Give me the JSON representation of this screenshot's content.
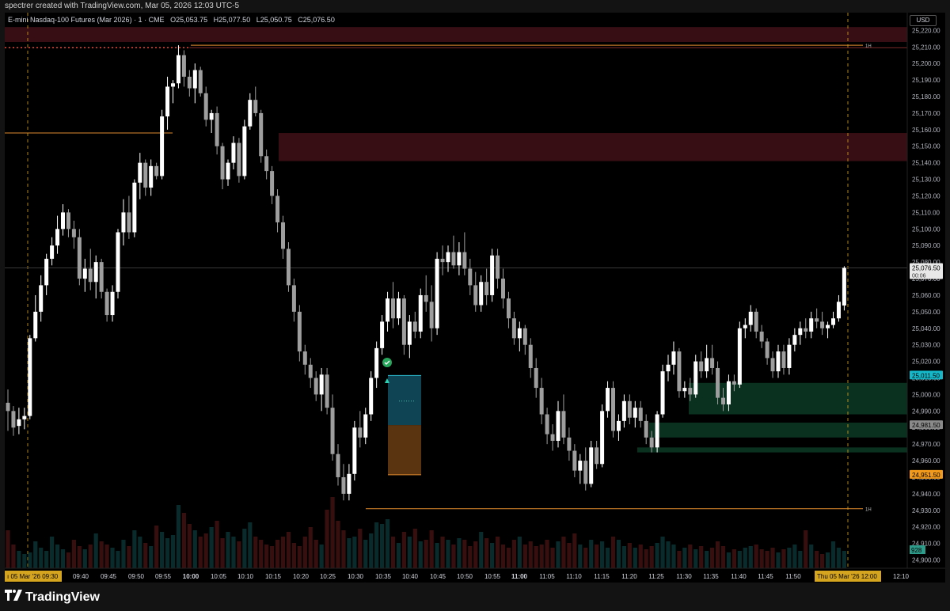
{
  "header": {
    "credit": "spectrer created with TradingView.com, Mar 05, 2026 12:03 UTC-5",
    "instrument": "E-mini Nasdaq-100 Futures (Mar 2026) · 1 · CME",
    "open": "O25,053.75",
    "high": "H25,077.50",
    "low": "L25,050.75",
    "close": "C25,076.50",
    "currency": "USD"
  },
  "footer": {
    "brand": "TradingView"
  },
  "colors": {
    "background": "#000000",
    "up": "#ffffff",
    "down": "#9e9e9e",
    "supply_zone": "#3a0f14",
    "demand_zone": "#0c3a26",
    "level": "#e08a2e",
    "session": "#d6a520",
    "tp_box": "#0e4453",
    "sl_box": "#5a3310"
  },
  "chart_data": {
    "type": "candlestick",
    "ylim": [
      24895,
      25224
    ],
    "y_ticks": [
      "25,220.00",
      "25,210.00",
      "25,200.00",
      "25,190.00",
      "25,180.00",
      "25,170.00",
      "25,160.00",
      "25,150.00",
      "25,140.00",
      "25,130.00",
      "25,120.00",
      "25,110.00",
      "25,100.00",
      "25,090.00",
      "25,080.00",
      "25,070.00",
      "25,060.00",
      "25,050.00",
      "25,040.00",
      "25,030.00",
      "25,020.00",
      "25,010.00",
      "25,000.00",
      "24,990.00",
      "24,980.00",
      "24,970.00",
      "24,960.00",
      "24,950.00",
      "24,940.00",
      "24,930.00",
      "24,920.00",
      "24,910.00",
      "24,900.00"
    ],
    "x_labels": [
      {
        "t": "09:40",
        "bold": false
      },
      {
        "t": "09:45",
        "bold": false
      },
      {
        "t": "09:50",
        "bold": false
      },
      {
        "t": "09:55",
        "bold": false
      },
      {
        "t": "10:00",
        "bold": true
      },
      {
        "t": "10:05",
        "bold": false
      },
      {
        "t": "10:10",
        "bold": false
      },
      {
        "t": "10:15",
        "bold": false
      },
      {
        "t": "10:20",
        "bold": false
      },
      {
        "t": "10:25",
        "bold": false
      },
      {
        "t": "10:30",
        "bold": false
      },
      {
        "t": "10:35",
        "bold": false
      },
      {
        "t": "10:40",
        "bold": false
      },
      {
        "t": "10:45",
        "bold": false
      },
      {
        "t": "10:50",
        "bold": false
      },
      {
        "t": "10:55",
        "bold": false
      },
      {
        "t": "11:00",
        "bold": true
      },
      {
        "t": "11:05",
        "bold": false
      },
      {
        "t": "11:10",
        "bold": false
      },
      {
        "t": "11:15",
        "bold": false
      },
      {
        "t": "11:20",
        "bold": false
      },
      {
        "t": "11:25",
        "bold": false
      },
      {
        "t": "11:30",
        "bold": false
      },
      {
        "t": "11:35",
        "bold": false
      },
      {
        "t": "11:40",
        "bold": false
      },
      {
        "t": "11:45",
        "bold": false
      },
      {
        "t": "11:50",
        "bold": false
      },
      {
        "t": "12:10",
        "bold": false
      }
    ],
    "session_labels": {
      "start": "ı 05 Mar '26  09:30",
      "end": "Thu 05 Mar '26  12:00"
    },
    "price_tags": [
      {
        "price": 25076.5,
        "label": "25,076.50",
        "sub": "00:06",
        "style": "current"
      },
      {
        "price": 25011.5,
        "label": "25,011.50",
        "style": "teal"
      },
      {
        "price": 24981.5,
        "label": "24,981.50",
        "style": "gray"
      },
      {
        "price": 24951.5,
        "label": "24,951.50",
        "style": "orange"
      }
    ],
    "volume_tag": "928",
    "levels": [
      {
        "price": 25211,
        "x0": 241,
        "x1": 1090,
        "label": "1H"
      },
      {
        "price": 24931,
        "x0": 462,
        "x1": 1090,
        "label": "1H"
      },
      {
        "price": 25158,
        "x0": 6,
        "x1": 218,
        "label": ""
      }
    ],
    "zones": [
      {
        "top": 25222,
        "bottom": 25213,
        "kind": "supply"
      },
      {
        "top": 25158,
        "bottom": 25141,
        "kind": "supply",
        "x0": 352
      },
      {
        "top": 25007,
        "bottom": 24988,
        "kind": "demand",
        "x0": 870
      },
      {
        "top": 24983,
        "bottom": 24974,
        "kind": "demand",
        "x0": 820
      },
      {
        "top": 24968,
        "bottom": 24965,
        "kind": "demand",
        "x0": 805
      }
    ],
    "trade": {
      "entry": 24981.5,
      "target": 25011.5,
      "stop": 24951.5
    },
    "candles": [
      {
        "o": 24995,
        "h": 25003,
        "l": 24978,
        "c": 24990
      },
      {
        "o": 24990,
        "h": 24993,
        "l": 24975,
        "c": 24980
      },
      {
        "o": 24981,
        "h": 24992,
        "l": 24976,
        "c": 24985
      },
      {
        "o": 24985,
        "h": 24992,
        "l": 24979,
        "c": 24987
      },
      {
        "o": 24987,
        "h": 25036,
        "l": 24985,
        "c": 25034
      },
      {
        "o": 25034,
        "h": 25060,
        "l": 25032,
        "c": 25050
      },
      {
        "o": 25050,
        "h": 25072,
        "l": 25044,
        "c": 25066
      },
      {
        "o": 25066,
        "h": 25085,
        "l": 25060,
        "c": 25082
      },
      {
        "o": 25082,
        "h": 25095,
        "l": 25078,
        "c": 25090
      },
      {
        "o": 25090,
        "h": 25108,
        "l": 25085,
        "c": 25100
      },
      {
        "o": 25100,
        "h": 25115,
        "l": 25096,
        "c": 25110
      },
      {
        "o": 25110,
        "h": 25112,
        "l": 25095,
        "c": 25100
      },
      {
        "o": 25100,
        "h": 25105,
        "l": 25088,
        "c": 25095
      },
      {
        "o": 25095,
        "h": 25100,
        "l": 25066,
        "c": 25070
      },
      {
        "o": 25070,
        "h": 25082,
        "l": 25062,
        "c": 25076
      },
      {
        "o": 25076,
        "h": 25088,
        "l": 25063,
        "c": 25068
      },
      {
        "o": 25068,
        "h": 25084,
        "l": 25058,
        "c": 25080
      },
      {
        "o": 25080,
        "h": 25082,
        "l": 25058,
        "c": 25062
      },
      {
        "o": 25062,
        "h": 25064,
        "l": 25044,
        "c": 25048
      },
      {
        "o": 25048,
        "h": 25066,
        "l": 25044,
        "c": 25062
      },
      {
        "o": 25062,
        "h": 25100,
        "l": 25058,
        "c": 25098
      },
      {
        "o": 25098,
        "h": 25118,
        "l": 25090,
        "c": 25110
      },
      {
        "o": 25110,
        "h": 25120,
        "l": 25094,
        "c": 25098
      },
      {
        "o": 25098,
        "h": 25130,
        "l": 25095,
        "c": 25128
      },
      {
        "o": 25128,
        "h": 25146,
        "l": 25118,
        "c": 25140
      },
      {
        "o": 25140,
        "h": 25142,
        "l": 25120,
        "c": 25125
      },
      {
        "o": 25125,
        "h": 25142,
        "l": 25120,
        "c": 25138
      },
      {
        "o": 25138,
        "h": 25140,
        "l": 25130,
        "c": 25132
      },
      {
        "o": 25132,
        "h": 25172,
        "l": 25130,
        "c": 25168
      },
      {
        "o": 25168,
        "h": 25192,
        "l": 25160,
        "c": 25186
      },
      {
        "o": 25186,
        "h": 25190,
        "l": 25176,
        "c": 25188
      },
      {
        "o": 25188,
        "h": 25211,
        "l": 25185,
        "c": 25205
      },
      {
        "o": 25205,
        "h": 25208,
        "l": 25186,
        "c": 25192
      },
      {
        "o": 25192,
        "h": 25196,
        "l": 25180,
        "c": 25185
      },
      {
        "o": 25185,
        "h": 25200,
        "l": 25176,
        "c": 25196
      },
      {
        "o": 25196,
        "h": 25198,
        "l": 25180,
        "c": 25182
      },
      {
        "o": 25182,
        "h": 25186,
        "l": 25162,
        "c": 25166
      },
      {
        "o": 25166,
        "h": 25172,
        "l": 25158,
        "c": 25170
      },
      {
        "o": 25170,
        "h": 25174,
        "l": 25145,
        "c": 25150
      },
      {
        "o": 25150,
        "h": 25152,
        "l": 25124,
        "c": 25130
      },
      {
        "o": 25130,
        "h": 25142,
        "l": 25126,
        "c": 25140
      },
      {
        "o": 25140,
        "h": 25156,
        "l": 25136,
        "c": 25152
      },
      {
        "o": 25152,
        "h": 25155,
        "l": 25128,
        "c": 25132
      },
      {
        "o": 25132,
        "h": 25166,
        "l": 25130,
        "c": 25162
      },
      {
        "o": 25162,
        "h": 25182,
        "l": 25160,
        "c": 25178
      },
      {
        "o": 25178,
        "h": 25186,
        "l": 25168,
        "c": 25170
      },
      {
        "o": 25170,
        "h": 25172,
        "l": 25140,
        "c": 25144
      },
      {
        "o": 25144,
        "h": 25148,
        "l": 25130,
        "c": 25135
      },
      {
        "o": 25135,
        "h": 25138,
        "l": 25115,
        "c": 25120
      },
      {
        "o": 25120,
        "h": 25124,
        "l": 25098,
        "c": 25104
      },
      {
        "o": 25104,
        "h": 25108,
        "l": 25082,
        "c": 25088
      },
      {
        "o": 25088,
        "h": 25092,
        "l": 25062,
        "c": 25066
      },
      {
        "o": 25066,
        "h": 25070,
        "l": 25044,
        "c": 25050
      },
      {
        "o": 25050,
        "h": 25054,
        "l": 25020,
        "c": 25026
      },
      {
        "o": 25026,
        "h": 25030,
        "l": 25012,
        "c": 25018
      },
      {
        "o": 25018,
        "h": 25022,
        "l": 25004,
        "c": 25010
      },
      {
        "o": 25010,
        "h": 25014,
        "l": 24996,
        "c": 25000
      },
      {
        "o": 25000,
        "h": 25016,
        "l": 24990,
        "c": 25012
      },
      {
        "o": 25012,
        "h": 25016,
        "l": 24988,
        "c": 24992
      },
      {
        "o": 24992,
        "h": 25000,
        "l": 24960,
        "c": 24964
      },
      {
        "o": 24964,
        "h": 24970,
        "l": 24945,
        "c": 24950
      },
      {
        "o": 24950,
        "h": 24958,
        "l": 24936,
        "c": 24940
      },
      {
        "o": 24940,
        "h": 24958,
        "l": 24936,
        "c": 24952
      },
      {
        "o": 24952,
        "h": 24984,
        "l": 24948,
        "c": 24980
      },
      {
        "o": 24980,
        "h": 24990,
        "l": 24968,
        "c": 24974
      },
      {
        "o": 24974,
        "h": 24992,
        "l": 24970,
        "c": 24988
      },
      {
        "o": 24988,
        "h": 25014,
        "l": 24984,
        "c": 25010
      },
      {
        "o": 25010,
        "h": 25032,
        "l": 25004,
        "c": 25028
      },
      {
        "o": 25028,
        "h": 25048,
        "l": 25024,
        "c": 25044
      },
      {
        "o": 25044,
        "h": 25062,
        "l": 25038,
        "c": 25058
      },
      {
        "o": 25058,
        "h": 25068,
        "l": 25040,
        "c": 25046
      },
      {
        "o": 25046,
        "h": 25062,
        "l": 25042,
        "c": 25058
      },
      {
        "o": 25058,
        "h": 25060,
        "l": 25024,
        "c": 25030
      },
      {
        "o": 25030,
        "h": 25048,
        "l": 25022,
        "c": 25044
      },
      {
        "o": 25044,
        "h": 25050,
        "l": 25034,
        "c": 25038
      },
      {
        "o": 25038,
        "h": 25064,
        "l": 25034,
        "c": 25060
      },
      {
        "o": 25060,
        "h": 25072,
        "l": 25050,
        "c": 25056
      },
      {
        "o": 25056,
        "h": 25066,
        "l": 25032,
        "c": 25040
      },
      {
        "o": 25040,
        "h": 25086,
        "l": 25036,
        "c": 25082
      },
      {
        "o": 25082,
        "h": 25090,
        "l": 25072,
        "c": 25080
      },
      {
        "o": 25080,
        "h": 25090,
        "l": 25074,
        "c": 25086
      },
      {
        "o": 25086,
        "h": 25096,
        "l": 25076,
        "c": 25078
      },
      {
        "o": 25078,
        "h": 25092,
        "l": 25072,
        "c": 25086
      },
      {
        "o": 25086,
        "h": 25098,
        "l": 25072,
        "c": 25076
      },
      {
        "o": 25076,
        "h": 25082,
        "l": 25060,
        "c": 25066
      },
      {
        "o": 25066,
        "h": 25074,
        "l": 25050,
        "c": 25054
      },
      {
        "o": 25054,
        "h": 25072,
        "l": 25050,
        "c": 25068
      },
      {
        "o": 25068,
        "h": 25076,
        "l": 25054,
        "c": 25060
      },
      {
        "o": 25060,
        "h": 25088,
        "l": 25056,
        "c": 25084
      },
      {
        "o": 25084,
        "h": 25088,
        "l": 25064,
        "c": 25070
      },
      {
        "o": 25070,
        "h": 25076,
        "l": 25052,
        "c": 25058
      },
      {
        "o": 25058,
        "h": 25062,
        "l": 25040,
        "c": 25046
      },
      {
        "o": 25046,
        "h": 25050,
        "l": 25030,
        "c": 25034
      },
      {
        "o": 25034,
        "h": 25044,
        "l": 25026,
        "c": 25040
      },
      {
        "o": 25040,
        "h": 25042,
        "l": 25024,
        "c": 25030
      },
      {
        "o": 25030,
        "h": 25034,
        "l": 25010,
        "c": 25016
      },
      {
        "o": 25016,
        "h": 25022,
        "l": 24998,
        "c": 25004
      },
      {
        "o": 25004,
        "h": 25010,
        "l": 24982,
        "c": 24988
      },
      {
        "o": 24988,
        "h": 24992,
        "l": 24970,
        "c": 24976
      },
      {
        "o": 24976,
        "h": 24982,
        "l": 24966,
        "c": 24972
      },
      {
        "o": 24972,
        "h": 24996,
        "l": 24968,
        "c": 24990
      },
      {
        "o": 24990,
        "h": 25000,
        "l": 24970,
        "c": 24974
      },
      {
        "o": 24974,
        "h": 24980,
        "l": 24960,
        "c": 24966
      },
      {
        "o": 24966,
        "h": 24970,
        "l": 24950,
        "c": 24954
      },
      {
        "o": 24954,
        "h": 24964,
        "l": 24946,
        "c": 24960
      },
      {
        "o": 24960,
        "h": 24968,
        "l": 24942,
        "c": 24946
      },
      {
        "o": 24946,
        "h": 24972,
        "l": 24944,
        "c": 24968
      },
      {
        "o": 24968,
        "h": 24972,
        "l": 24955,
        "c": 24958
      },
      {
        "o": 24958,
        "h": 24994,
        "l": 24956,
        "c": 24990
      },
      {
        "o": 24990,
        "h": 25008,
        "l": 24986,
        "c": 25004
      },
      {
        "o": 25004,
        "h": 25008,
        "l": 24974,
        "c": 24978
      },
      {
        "o": 24978,
        "h": 24988,
        "l": 24972,
        "c": 24984
      },
      {
        "o": 24984,
        "h": 25000,
        "l": 24980,
        "c": 24996
      },
      {
        "o": 24996,
        "h": 25000,
        "l": 24982,
        "c": 24986
      },
      {
        "o": 24986,
        "h": 24996,
        "l": 24980,
        "c": 24992
      },
      {
        "o": 24992,
        "h": 24996,
        "l": 24980,
        "c": 24984
      },
      {
        "o": 24984,
        "h": 24988,
        "l": 24970,
        "c": 24974
      },
      {
        "o": 24974,
        "h": 24978,
        "l": 24965,
        "c": 24968
      },
      {
        "o": 24968,
        "h": 24990,
        "l": 24965,
        "c": 24988
      },
      {
        "o": 24988,
        "h": 25018,
        "l": 24986,
        "c": 25014
      },
      {
        "o": 25014,
        "h": 25024,
        "l": 25008,
        "c": 25018
      },
      {
        "o": 25018,
        "h": 25032,
        "l": 25012,
        "c": 25026
      },
      {
        "o": 25026,
        "h": 25028,
        "l": 24998,
        "c": 25002
      },
      {
        "o": 25002,
        "h": 25008,
        "l": 24998,
        "c": 25004
      },
      {
        "o": 25004,
        "h": 25010,
        "l": 24996,
        "c": 25000
      },
      {
        "o": 25000,
        "h": 25024,
        "l": 24998,
        "c": 25020
      },
      {
        "o": 25020,
        "h": 25026,
        "l": 25010,
        "c": 25014
      },
      {
        "o": 25014,
        "h": 25030,
        "l": 25010,
        "c": 25022
      },
      {
        "o": 25022,
        "h": 25030,
        "l": 25012,
        "c": 25016
      },
      {
        "o": 25016,
        "h": 25020,
        "l": 24994,
        "c": 24998
      },
      {
        "o": 24998,
        "h": 25004,
        "l": 24990,
        "c": 24994
      },
      {
        "o": 24994,
        "h": 25012,
        "l": 24990,
        "c": 25008
      },
      {
        "o": 25008,
        "h": 25012,
        "l": 25002,
        "c": 25006
      },
      {
        "o": 25006,
        "h": 25044,
        "l": 25004,
        "c": 25040
      },
      {
        "o": 25040,
        "h": 25046,
        "l": 25034,
        "c": 25042
      },
      {
        "o": 25042,
        "h": 25054,
        "l": 25038,
        "c": 25050
      },
      {
        "o": 25050,
        "h": 25052,
        "l": 25034,
        "c": 25038
      },
      {
        "o": 25038,
        "h": 25042,
        "l": 25028,
        "c": 25032
      },
      {
        "o": 25032,
        "h": 25034,
        "l": 25018,
        "c": 25022
      },
      {
        "o": 25022,
        "h": 25026,
        "l": 25010,
        "c": 25014
      },
      {
        "o": 25014,
        "h": 25030,
        "l": 25010,
        "c": 25026
      },
      {
        "o": 25026,
        "h": 25030,
        "l": 25012,
        "c": 25016
      },
      {
        "o": 25016,
        "h": 25034,
        "l": 25012,
        "c": 25030
      },
      {
        "o": 25030,
        "h": 25040,
        "l": 25026,
        "c": 25036
      },
      {
        "o": 25036,
        "h": 25044,
        "l": 25030,
        "c": 25040
      },
      {
        "o": 25040,
        "h": 25046,
        "l": 25034,
        "c": 25038
      },
      {
        "o": 25038,
        "h": 25050,
        "l": 25034,
        "c": 25046
      },
      {
        "o": 25046,
        "h": 25052,
        "l": 25040,
        "c": 25044
      },
      {
        "o": 25044,
        "h": 25050,
        "l": 25036,
        "c": 25040
      },
      {
        "o": 25040,
        "h": 25044,
        "l": 25034,
        "c": 25042
      },
      {
        "o": 25042,
        "h": 25050,
        "l": 25040,
        "c": 25046
      },
      {
        "o": 25046,
        "h": 25060,
        "l": 25044,
        "c": 25056
      },
      {
        "o": 25053.75,
        "h": 25077.5,
        "l": 25050.75,
        "c": 25076.5
      }
    ]
  }
}
